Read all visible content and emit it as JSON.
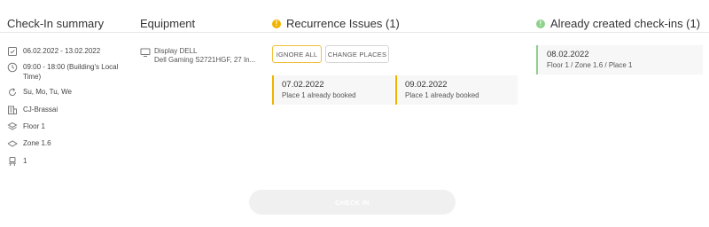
{
  "summary": {
    "title": "Check-In summary",
    "items": [
      {
        "icon": "calendar-check-icon",
        "text": "06.02.2022 - 13.02.2022"
      },
      {
        "icon": "clock-icon",
        "text": "09:00 - 18:00 (Building's Local Time)"
      },
      {
        "icon": "repeat-icon",
        "text": "Su, Mo, Tu, We"
      },
      {
        "icon": "building-icon",
        "text": "CJ-Brassai"
      },
      {
        "icon": "layers-icon",
        "text": "Floor 1"
      },
      {
        "icon": "zone-icon",
        "text": "Zone 1.6"
      },
      {
        "icon": "desk-chair-icon",
        "text": "1"
      }
    ]
  },
  "equipment": {
    "title": "Equipment",
    "icon": "monitor-icon",
    "line1": "Display DELL",
    "line2": "Dell Gaming S2721HGF, 27 In..."
  },
  "issues": {
    "title": "Recurrence Issues (1)",
    "status_icon": "warning-icon",
    "accent": "#f0b400",
    "ignore_label": "IGNORE ALL",
    "change_label": "CHANGE PLACES",
    "cards": [
      {
        "date": "07.02.2022",
        "text": "Place 1 already booked"
      },
      {
        "date": "09.02.2022",
        "text": "Place 1 already booked"
      }
    ]
  },
  "created": {
    "title": "Already created check-ins (1)",
    "status_icon": "info-icon",
    "accent": "#8dd18a",
    "cards": [
      {
        "date": "08.02.2022",
        "text": "Floor 1 / Zone 1.6 / Place 1"
      }
    ]
  },
  "checkin_label": "CHECK IN"
}
